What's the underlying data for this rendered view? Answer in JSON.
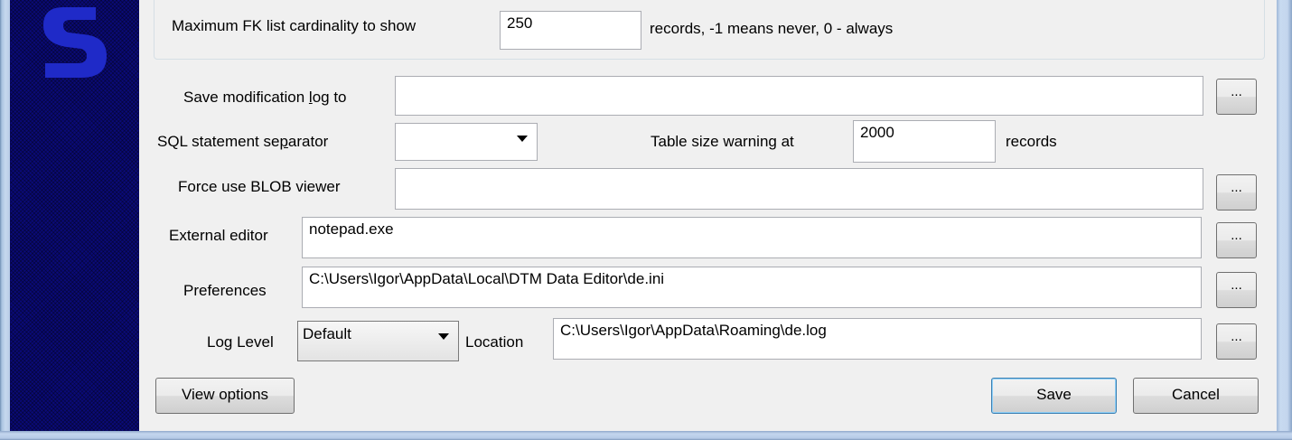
{
  "fk": {
    "label": "Maximum FK list cardinality to show",
    "value": "250",
    "suffix": "records, -1 means never, 0 - always"
  },
  "save_log": {
    "label_pre": "Save modification ",
    "label_u": "l",
    "label_post": "og to",
    "value": "",
    "browse_label": "..."
  },
  "separator": {
    "label_pre": "SQL statement se",
    "label_u": "p",
    "label_post": "arator",
    "value": ""
  },
  "table_warning": {
    "label": "Table size warning at",
    "value": "2000",
    "suffix": "records"
  },
  "blob": {
    "label": "Force use BLOB viewer",
    "value": "",
    "browse_label": "..."
  },
  "editor": {
    "label": "External editor",
    "value": "notepad.exe",
    "browse_label": "..."
  },
  "preferences": {
    "label": "Preferences",
    "value": "C:\\Users\\Igor\\AppData\\Local\\DTM Data Editor\\de.ini",
    "browse_label": "..."
  },
  "log": {
    "label": "Log Level",
    "level": "Default",
    "location_label": "Location",
    "location": "C:\\Users\\Igor\\AppData\\Roaming\\de.log",
    "browse_label": "..."
  },
  "buttons": {
    "view_options": "View options",
    "save": "Save",
    "cancel": "Cancel"
  },
  "colors": {
    "sidebar": "#0a0a78",
    "logo": "#1f2ac8",
    "dialog_bg": "#f0f0f0",
    "default_button_border": "#3c7fb1"
  }
}
